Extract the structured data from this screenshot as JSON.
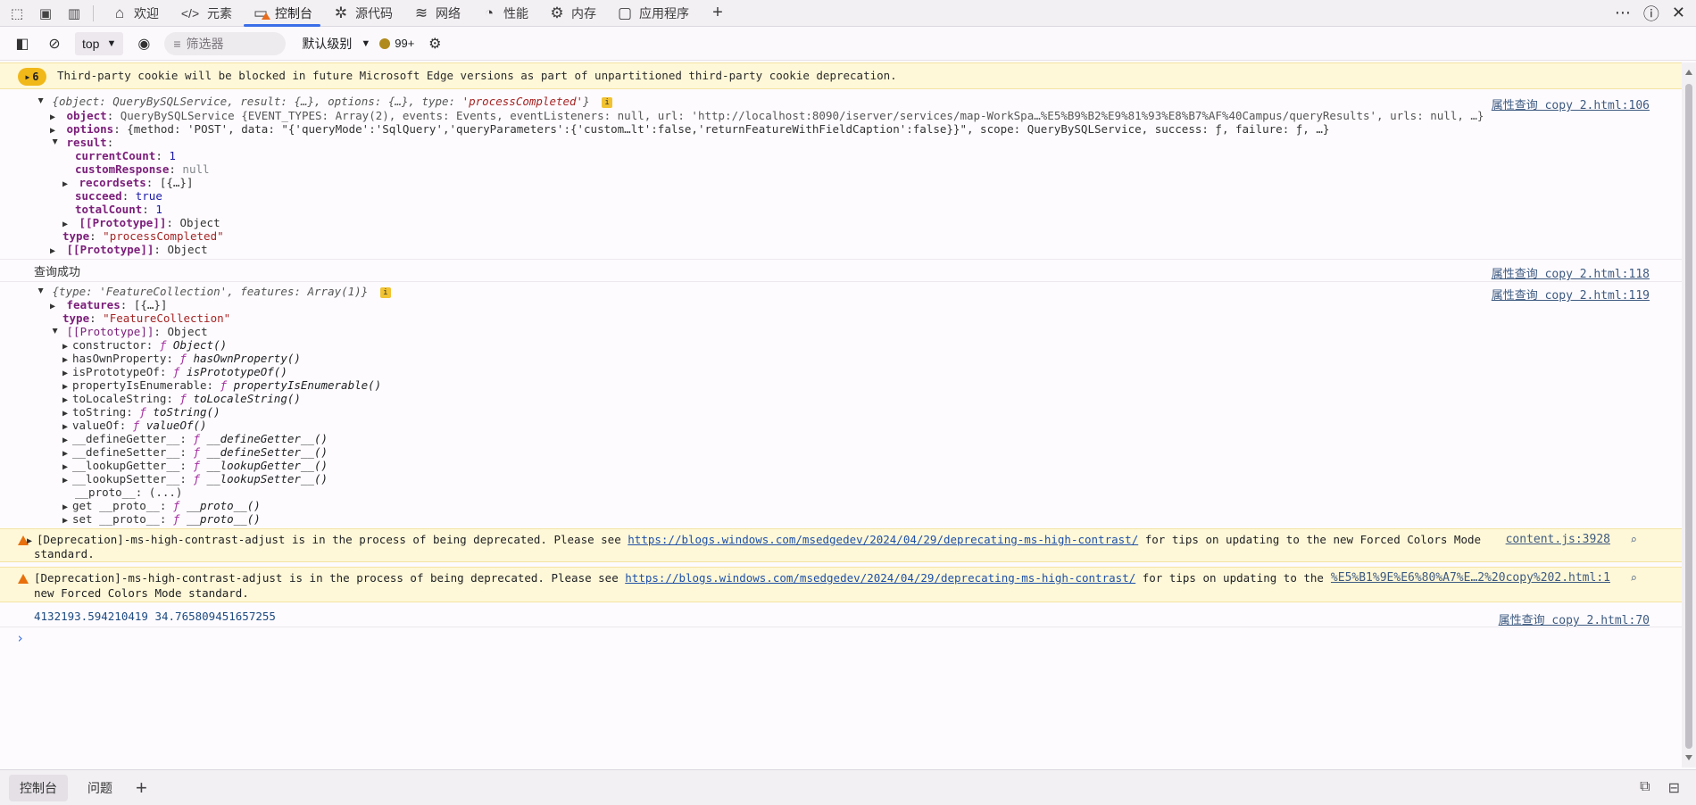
{
  "tabs": [
    {
      "label": "欢迎",
      "icon": "home-icon",
      "glyph": "⌂"
    },
    {
      "label": "元素",
      "icon": "code-icon",
      "glyph": "</>"
    },
    {
      "label": "控制台",
      "icon": "console-icon",
      "glyph": "▭"
    },
    {
      "label": "源代码",
      "icon": "bug-icon",
      "glyph": "✲"
    },
    {
      "label": "网络",
      "icon": "wifi-icon",
      "glyph": "≋"
    },
    {
      "label": "性能",
      "icon": "performance-icon",
      "glyph": "◔"
    },
    {
      "label": "内存",
      "icon": "memory-icon",
      "glyph": "⚙"
    },
    {
      "label": "应用程序",
      "icon": "application-icon",
      "glyph": "▢"
    }
  ],
  "toolbar": {
    "context": "top",
    "filter_placeholder": "筛选器",
    "level": "默认级别",
    "issues": "99+"
  },
  "banner": {
    "count": "6",
    "text": "Third-party cookie will be blocked in future Microsoft Edge versions as part of unpartitioned third-party cookie deprecation."
  },
  "log1": {
    "summary_pre": "{object: QueryBySQLService, result: {…}, options: {…}, type: ",
    "summary_type": "'processCompleted'",
    "summary_post": "}",
    "source": "属性查询 copy 2.html:106",
    "object_key": "object",
    "object_val": "QueryBySQLService {EVENT_TYPES: Array(2), events: Events, eventListeners: null, url: 'http://localhost:8090/iserver/services/map-WorkSpa…%E5%B9%B2%E9%81%93%E8%B7%AF%40Campus/queryResults', urls: null, …}",
    "options_key": "options",
    "options_val": "{method: 'POST', data: \"{'queryMode':'SqlQuery','queryParameters':{'custom…lt':false,'returnFeatureWithFieldCaption':false}}\", scope: QueryBySQLService, success: ƒ, failure: ƒ, …}",
    "result_key": "result",
    "currentCount_key": "currentCount",
    "currentCount_val": "1",
    "customResponse_key": "customResponse",
    "customResponse_val": "null",
    "recordsets_key": "recordsets",
    "recordsets_val": "[{…}]",
    "succeed_key": "succeed",
    "succeed_val": "true",
    "totalCount_key": "totalCount",
    "totalCount_val": "1",
    "proto_key": "[[Prototype]]",
    "proto_val": "Object",
    "type_key": "type",
    "type_val": "\"processCompleted\""
  },
  "log2": {
    "text": "查询成功",
    "source": "属性查询 copy 2.html:118"
  },
  "log3": {
    "summary": "{type: 'FeatureCollection', features: Array(1)}",
    "source": "属性查询 copy 2.html:119",
    "features_key": "features",
    "features_val": "[{…}]",
    "type_key": "type",
    "type_val": "\"FeatureCollection\"",
    "proto_key": "[[Prototype]]",
    "proto_val": "Object",
    "members": [
      {
        "key": "constructor",
        "fn": "Object()"
      },
      {
        "key": "hasOwnProperty",
        "fn": "hasOwnProperty()"
      },
      {
        "key": "isPrototypeOf",
        "fn": "isPrototypeOf()"
      },
      {
        "key": "propertyIsEnumerable",
        "fn": "propertyIsEnumerable()"
      },
      {
        "key": "toLocaleString",
        "fn": "toLocaleString()"
      },
      {
        "key": "toString",
        "fn": "toString()"
      },
      {
        "key": "valueOf",
        "fn": "valueOf()"
      },
      {
        "key": "__defineGetter__",
        "fn": "__defineGetter__()"
      },
      {
        "key": "__defineSetter__",
        "fn": "__defineSetter__()"
      },
      {
        "key": "__lookupGetter__",
        "fn": "__lookupGetter__()"
      },
      {
        "key": "__lookupSetter__",
        "fn": "__lookupSetter__()"
      }
    ],
    "proto_plain_key": "__proto__",
    "proto_plain_val": "(...)",
    "get_proto": "get __proto__",
    "get_proto_fn": "__proto__()",
    "set_proto": "set __proto__",
    "set_proto_fn": "__proto__()"
  },
  "warn1": {
    "pre": "[Deprecation]-ms-high-contrast-adjust is in the process of being deprecated. Please see",
    "url": "https://blogs.windows.com/msedgedev/2024/04/29/deprecating-ms-high-contrast/",
    "post": "for tips on updating to the new Forced Colors Mode",
    "line2": "standard.",
    "source": "content.js:3928"
  },
  "warn2": {
    "pre": "[Deprecation]-ms-high-contrast-adjust is in the process of being deprecated. Please see",
    "url": "https://blogs.windows.com/msedgedev/2024/04/29/deprecating-ms-high-contrast/",
    "post": "for tips on updating to the",
    "line2": "new Forced Colors Mode standard.",
    "source": "%E5%B1%9E%E6%80%A7%E…2%20copy%202.html:1"
  },
  "log4": {
    "text": "4132193.594210419 34.765809451657255",
    "source": "属性查询 copy 2.html:70"
  },
  "drawer": {
    "tab_console": "控制台",
    "tab_issues": "问题"
  },
  "colors": {
    "accent": "#3a6ee8",
    "warning_bg": "#fff8d8",
    "warning_icon": "#e8700c",
    "issue_badge": "#f1b81a"
  }
}
